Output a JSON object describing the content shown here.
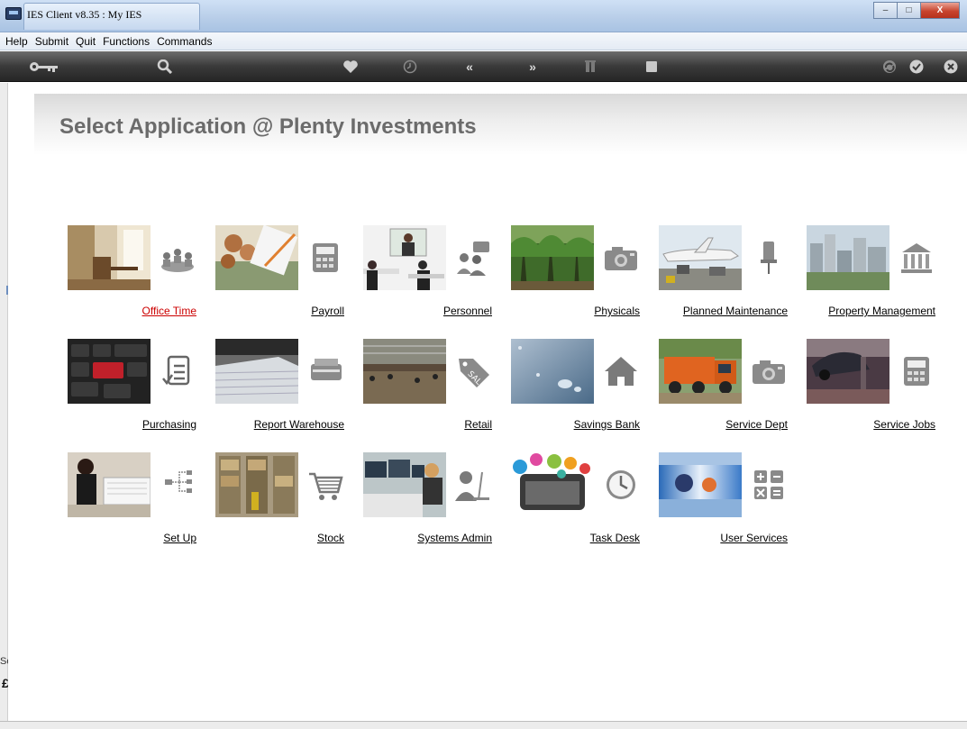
{
  "window": {
    "title": "IES Client v8.35 : My IES",
    "min_symbol": "–",
    "max_symbol": "□",
    "close_symbol": "X"
  },
  "menu": [
    "Help",
    "Submit",
    "Quit",
    "Functions",
    "Commands"
  ],
  "toolbar_icons": [
    "key-icon",
    "help-icon",
    "search-icon",
    "heart-icon",
    "clock-icon",
    "rewind-icon",
    "fast-forward-icon",
    "columns-icon",
    "stop-icon",
    "recycle-icon",
    "check-icon",
    "close-icon"
  ],
  "page": {
    "title": "Select Application @  Plenty Investments"
  },
  "sidebar": {
    "session_label": "Ses",
    "glyph": "£"
  },
  "applications": [
    {
      "label": "Office Time",
      "active": true,
      "icon": "meeting-icon"
    },
    {
      "label": "Payroll",
      "active": false,
      "icon": "cash-register-icon"
    },
    {
      "label": "Personnel",
      "active": false,
      "icon": "people-icon"
    },
    {
      "label": "Physicals",
      "active": false,
      "icon": "camera-icon"
    },
    {
      "label": "Planned Maintenance",
      "active": false,
      "icon": "pin-icon"
    },
    {
      "label": "Property Management",
      "active": false,
      "icon": "building-icon"
    },
    {
      "label": "Purchasing",
      "active": false,
      "icon": "checklist-icon"
    },
    {
      "label": "Report Warehouse",
      "active": false,
      "icon": "printer-icon"
    },
    {
      "label": "Retail",
      "active": false,
      "icon": "sale-tag-icon"
    },
    {
      "label": "Savings Bank",
      "active": false,
      "icon": "home-icon"
    },
    {
      "label": "Service Dept",
      "active": false,
      "icon": "camera-icon"
    },
    {
      "label": "Service Jobs",
      "active": false,
      "icon": "cash-register-icon"
    },
    {
      "label": "Set Up",
      "active": false,
      "icon": "hierarchy-icon"
    },
    {
      "label": "Stock",
      "active": false,
      "icon": "cart-icon"
    },
    {
      "label": "Systems Admin",
      "active": false,
      "icon": "admin-user-icon"
    },
    {
      "label": "Task Desk",
      "active": false,
      "icon": "clock-icon"
    },
    {
      "label": "User Services",
      "active": false,
      "icon": "calculator-icon"
    }
  ]
}
